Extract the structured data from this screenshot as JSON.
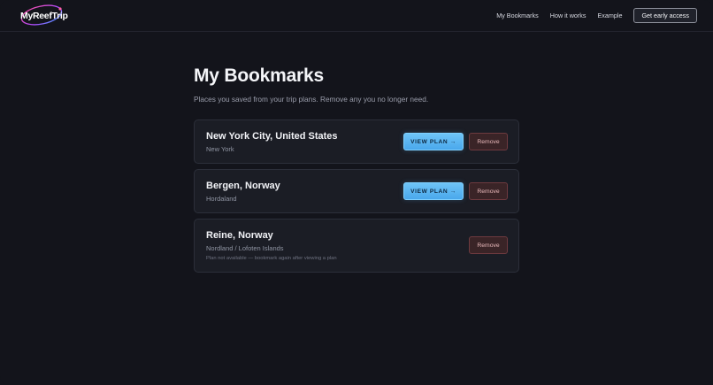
{
  "header": {
    "logo_text": "MyReefTrip",
    "nav": {
      "bookmarks": "My Bookmarks",
      "how_it_works": "How it works",
      "example": "Example"
    },
    "cta": "Get early access"
  },
  "main": {
    "title": "My Bookmarks",
    "subtitle": "Places you saved from your trip plans. Remove any you no longer need.",
    "bookmarks": [
      {
        "title": "New York City, United States",
        "region": "New York",
        "view_label": "VIEW PLAN →",
        "remove_label": "Remove"
      },
      {
        "title": "Bergen, Norway",
        "region": "Hordaland",
        "view_label": "VIEW PLAN →",
        "remove_label": "Remove"
      },
      {
        "title": "Reine, Norway",
        "region": "Nordland / Lofoten Islands",
        "note": "Plan not available — bookmark again after viewing a plan",
        "remove_label": "Remove"
      }
    ]
  },
  "colors": {
    "background": "#13141b",
    "card": "#1b1d25",
    "accent": "#5bb6f2",
    "danger": "#6e3a3f"
  }
}
